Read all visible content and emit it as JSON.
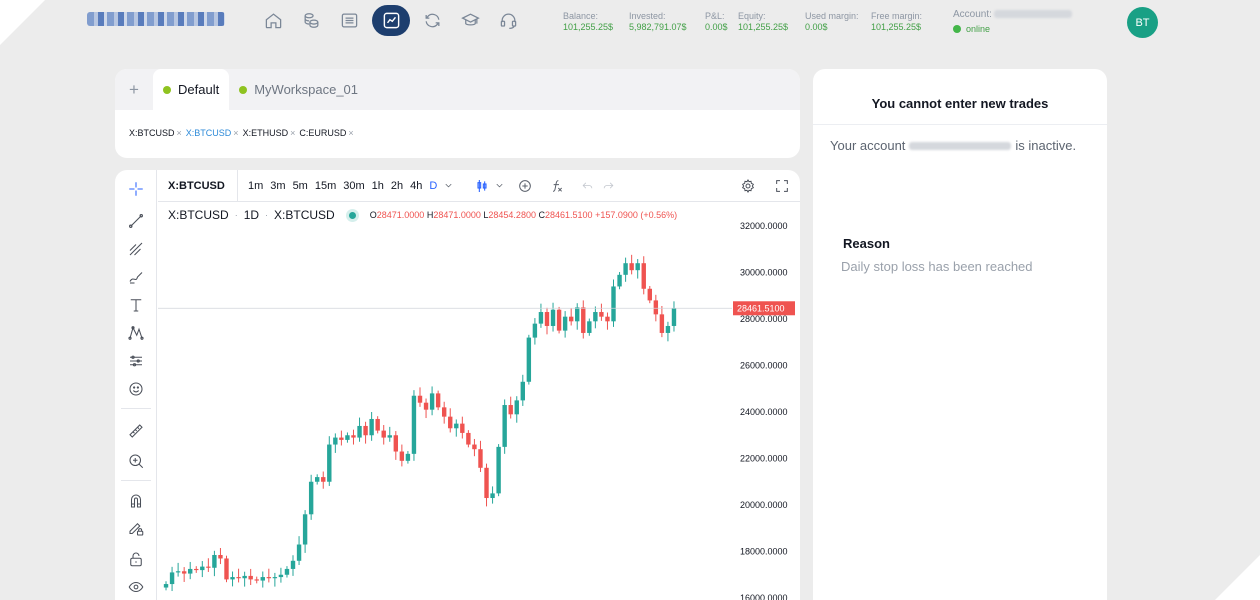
{
  "header": {
    "stats": [
      {
        "label": "Balance:",
        "value": "101,255.25$"
      },
      {
        "label": "Invested:",
        "value": "5,982,791.07$"
      },
      {
        "label": "P&L:",
        "value": "0.00$"
      },
      {
        "label": "Equity:",
        "value": "101,255.25$"
      },
      {
        "label": "Used margin:",
        "value": "0.00$"
      },
      {
        "label": "Free margin:",
        "value": "101,255.25$"
      }
    ],
    "account_label": "Account:",
    "status": "online",
    "avatar": "BT",
    "nav_icons": [
      "home-icon",
      "coins-icon",
      "list-icon",
      "chart-icon",
      "refresh-icon",
      "education-icon",
      "headset-icon"
    ],
    "active_nav": "chart-icon"
  },
  "workspace": {
    "tabs": [
      {
        "label": "Default",
        "active": true
      },
      {
        "label": "MyWorkspace_01",
        "active": false
      }
    ],
    "symbols": [
      {
        "label": "X:BTCUSD",
        "selected": false
      },
      {
        "label": "X:BTCUSD",
        "selected": true
      },
      {
        "label": "X:ETHUSD",
        "selected": false
      },
      {
        "label": "C:EURUSD",
        "selected": false
      }
    ]
  },
  "chart": {
    "symbol": "X:BTCUSD",
    "intervals": [
      "1m",
      "3m",
      "5m",
      "15m",
      "30m",
      "1h",
      "2h",
      "4h",
      "D"
    ],
    "active_interval": "D",
    "legend": {
      "title": "X:BTCUSD",
      "interval": "1D",
      "source": "X:BTCUSD",
      "open": "28471.0000",
      "high": "28471.0000",
      "low": "28454.2800",
      "close": "28461.5100",
      "change": "+157.0900 (+0.56%)"
    },
    "last_price_label": "28461.5100",
    "colors": {
      "up": "#26a69a",
      "down": "#ef5350"
    }
  },
  "chart_data": {
    "type": "candlestick",
    "y_ticks": [
      "32000.0000",
      "30000.0000",
      "28000.0000",
      "26000.0000",
      "24000.0000",
      "22000.0000",
      "20000.0000",
      "18000.0000",
      "16000.0000"
    ],
    "ylim": [
      16000,
      32600
    ],
    "last_price": 28461.51,
    "closes": [
      16600,
      17100,
      17150,
      17050,
      17250,
      17200,
      17350,
      17300,
      17850,
      17700,
      16800,
      16900,
      16850,
      16950,
      16800,
      16750,
      16900,
      16850,
      16900,
      17000,
      17250,
      17600,
      18300,
      19600,
      21000,
      21200,
      21000,
      22600,
      22900,
      22800,
      23000,
      22900,
      23400,
      23000,
      23700,
      23200,
      22900,
      23000,
      22300,
      21900,
      22200,
      24700,
      24400,
      24100,
      24800,
      24200,
      23800,
      23300,
      23500,
      23100,
      22600,
      22400,
      21600,
      20300,
      20500,
      22500,
      24300,
      23900,
      24500,
      25300,
      27200,
      27800,
      28300,
      27700,
      28400,
      27500,
      28100,
      27900,
      28500,
      27400,
      27900,
      28300,
      28100,
      27900,
      29400,
      29900,
      30400,
      30100,
      30400,
      29300,
      28800,
      28200,
      27400,
      27700,
      28460
    ],
    "highs_note": ""
  },
  "panel": {
    "title": "You cannot enter new trades",
    "inactive_prefix": "Your account",
    "inactive_suffix": "is inactive.",
    "reason_label": "Reason",
    "reason_text": "Daily stop loss has been reached"
  }
}
